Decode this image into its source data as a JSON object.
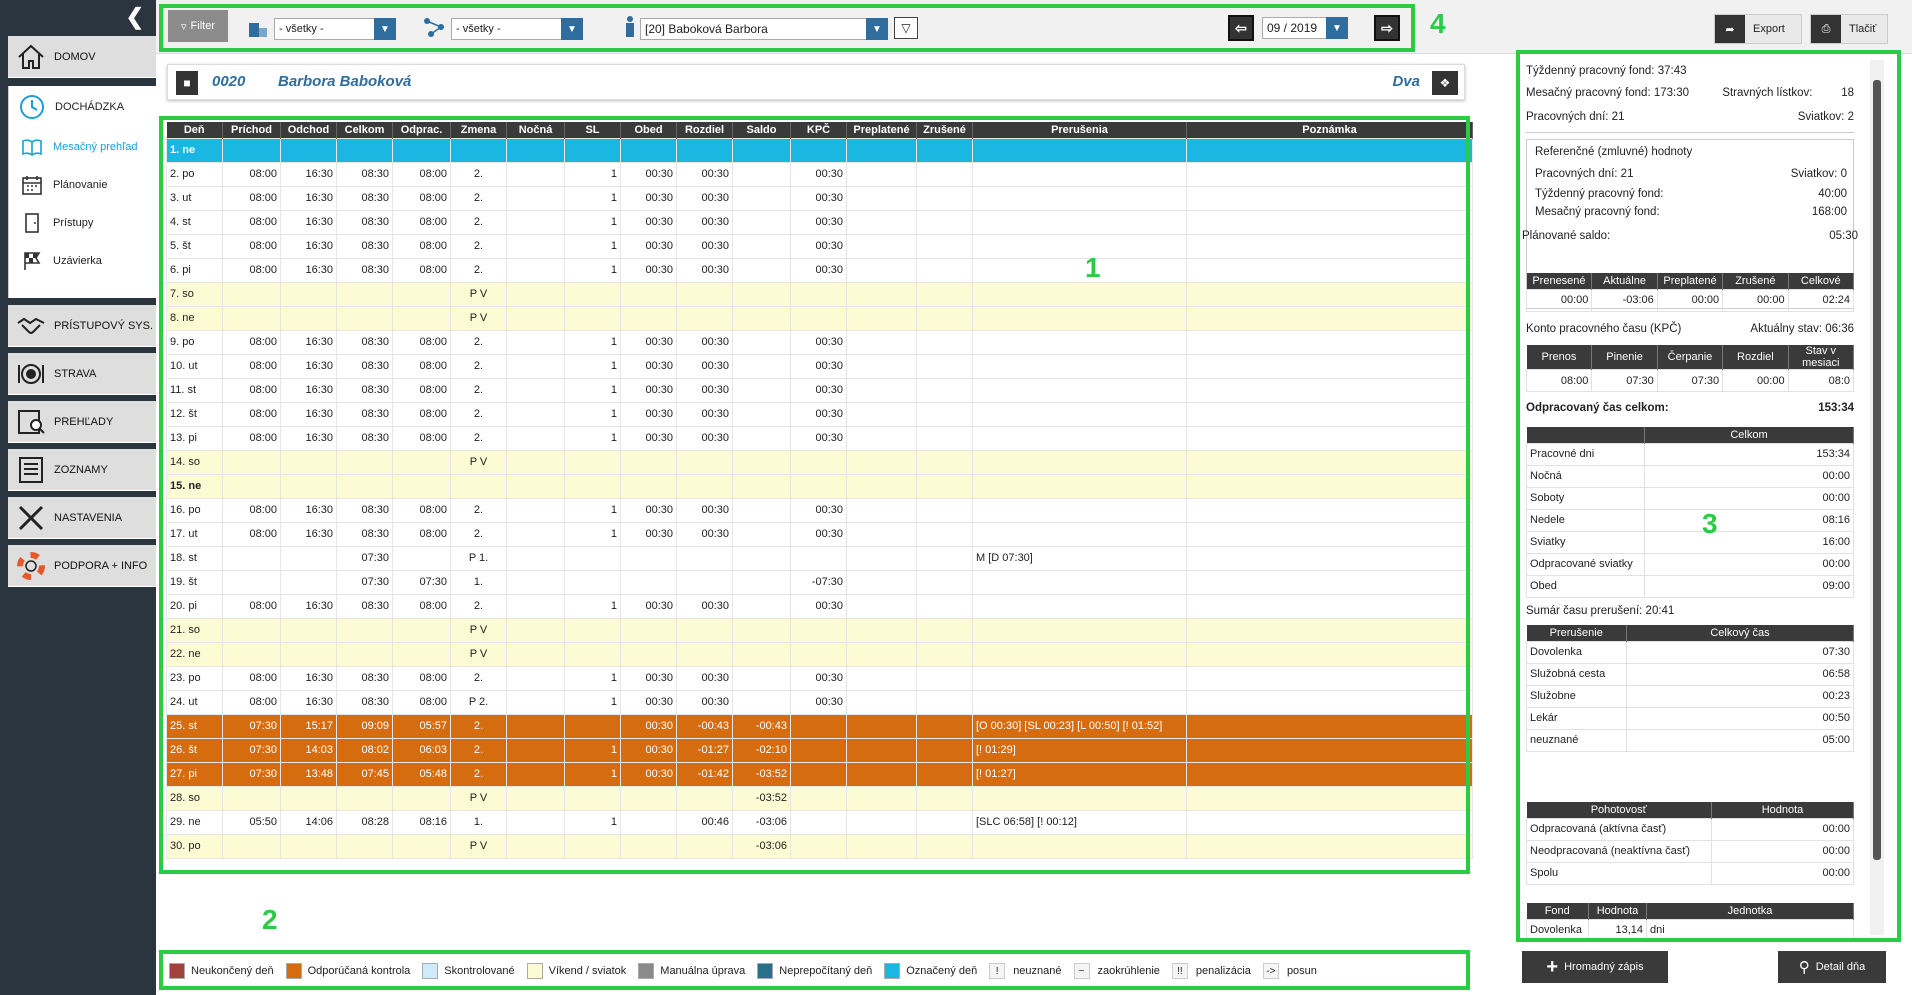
{
  "sidebar": {
    "items": [
      {
        "label": "DOMOV",
        "icon": "home-icon"
      },
      {
        "label": "DOCHÁDZKA",
        "icon": "clock-icon"
      },
      {
        "label": "PRÍSTUPOVÝ SYS.",
        "icon": "handshake-icon"
      },
      {
        "label": "STRAVA",
        "icon": "plate-icon"
      },
      {
        "label": "PREHĽADY",
        "icon": "report-icon"
      },
      {
        "label": "ZOZNAMY",
        "icon": "list-icon"
      },
      {
        "label": "NASTAVENIA",
        "icon": "tools-icon"
      },
      {
        "label": "PODPORA + INFO",
        "icon": "lifebuoy-icon"
      }
    ],
    "submenu": [
      {
        "label": "Mesačný prehľad",
        "icon": "book-icon",
        "active": true
      },
      {
        "label": "Plánovanie",
        "icon": "calendar-icon"
      },
      {
        "label": "Prístupy",
        "icon": "door-icon"
      },
      {
        "label": "Uzávierka",
        "icon": "flag-icon"
      }
    ]
  },
  "toolbar": {
    "filter_label": "Filter",
    "dept_value": "- všetky -",
    "group_value": "- všetky -",
    "employee_value": "[20] Baboková Barbora",
    "period_value": "09 / 2019",
    "export_label": "Export",
    "print_label": "Tlačiť"
  },
  "employee": {
    "number": "0020",
    "name": "Barbora Baboková",
    "shift": "Dva"
  },
  "annotations": {
    "a1": "1",
    "a2": "2",
    "a3": "3",
    "a4": "4"
  },
  "grid": {
    "headers": [
      "Deň",
      "Príchod",
      "Odchod",
      "Celkom",
      "Odprac.",
      "Zmena",
      "Nočná",
      "SL",
      "Obed",
      "Rozdiel",
      "Saldo",
      "KPČ",
      "Preplatené",
      "Zrušené",
      "Prerušenia",
      "Poznámka"
    ],
    "rows": [
      {
        "t": "selected",
        "c": [
          "1. ne",
          "",
          "",
          "",
          "",
          "",
          "",
          "",
          "",
          "",
          "",
          "",
          "",
          "",
          "",
          ""
        ]
      },
      {
        "t": "normal",
        "c": [
          "2. po",
          "08:00",
          "16:30",
          "08:30",
          "08:00",
          "2.",
          "",
          "1",
          "00:30",
          "00:30",
          "",
          "00:30",
          "",
          "",
          "",
          ""
        ]
      },
      {
        "t": "normal",
        "c": [
          "3. ut",
          "08:00",
          "16:30",
          "08:30",
          "08:00",
          "2.",
          "",
          "1",
          "00:30",
          "00:30",
          "",
          "00:30",
          "",
          "",
          "",
          ""
        ]
      },
      {
        "t": "normal",
        "c": [
          "4. st",
          "08:00",
          "16:30",
          "08:30",
          "08:00",
          "2.",
          "",
          "1",
          "00:30",
          "00:30",
          "",
          "00:30",
          "",
          "",
          "",
          ""
        ]
      },
      {
        "t": "normal",
        "c": [
          "5. št",
          "08:00",
          "16:30",
          "08:30",
          "08:00",
          "2.",
          "",
          "1",
          "00:30",
          "00:30",
          "",
          "00:30",
          "",
          "",
          "",
          ""
        ]
      },
      {
        "t": "normal",
        "c": [
          "6. pi",
          "08:00",
          "16:30",
          "08:30",
          "08:00",
          "2.",
          "",
          "1",
          "00:30",
          "00:30",
          "",
          "00:30",
          "",
          "",
          "",
          ""
        ]
      },
      {
        "t": "weekend",
        "c": [
          "7. so",
          "",
          "",
          "",
          "",
          "P V",
          "",
          "",
          "",
          "",
          "",
          "",
          "",
          "",
          "",
          ""
        ]
      },
      {
        "t": "weekend",
        "c": [
          "8. ne",
          "",
          "",
          "",
          "",
          "P V",
          "",
          "",
          "",
          "",
          "",
          "",
          "",
          "",
          "",
          ""
        ]
      },
      {
        "t": "normal",
        "c": [
          "9. po",
          "08:00",
          "16:30",
          "08:30",
          "08:00",
          "2.",
          "",
          "1",
          "00:30",
          "00:30",
          "",
          "00:30",
          "",
          "",
          "",
          ""
        ]
      },
      {
        "t": "normal",
        "c": [
          "10. ut",
          "08:00",
          "16:30",
          "08:30",
          "08:00",
          "2.",
          "",
          "1",
          "00:30",
          "00:30",
          "",
          "00:30",
          "",
          "",
          "",
          ""
        ]
      },
      {
        "t": "normal",
        "c": [
          "11. st",
          "08:00",
          "16:30",
          "08:30",
          "08:00",
          "2.",
          "",
          "1",
          "00:30",
          "00:30",
          "",
          "00:30",
          "",
          "",
          "",
          ""
        ]
      },
      {
        "t": "normal",
        "c": [
          "12. št",
          "08:00",
          "16:30",
          "08:30",
          "08:00",
          "2.",
          "",
          "1",
          "00:30",
          "00:30",
          "",
          "00:30",
          "",
          "",
          "",
          ""
        ]
      },
      {
        "t": "normal",
        "c": [
          "13. pi",
          "08:00",
          "16:30",
          "08:30",
          "08:00",
          "2.",
          "",
          "1",
          "00:30",
          "00:30",
          "",
          "00:30",
          "",
          "",
          "",
          ""
        ]
      },
      {
        "t": "weekend",
        "c": [
          "14. so",
          "",
          "",
          "",
          "",
          "P V",
          "",
          "",
          "",
          "",
          "",
          "",
          "",
          "",
          "",
          ""
        ]
      },
      {
        "t": "weekend bold",
        "c": [
          "15. ne",
          "",
          "",
          "",
          "",
          "",
          "",
          "",
          "",
          "",
          "",
          "",
          "",
          "",
          "",
          ""
        ]
      },
      {
        "t": "normal",
        "c": [
          "16. po",
          "08:00",
          "16:30",
          "08:30",
          "08:00",
          "2.",
          "",
          "1",
          "00:30",
          "00:30",
          "",
          "00:30",
          "",
          "",
          "",
          ""
        ]
      },
      {
        "t": "normal",
        "c": [
          "17. ut",
          "08:00",
          "16:30",
          "08:30",
          "08:00",
          "2.",
          "",
          "1",
          "00:30",
          "00:30",
          "",
          "00:30",
          "",
          "",
          "",
          ""
        ]
      },
      {
        "t": "normal",
        "c": [
          "18. st",
          "",
          "",
          "07:30",
          "",
          "P 1.",
          "",
          "",
          "",
          "",
          "",
          "",
          "",
          "",
          "M [D 07:30]",
          ""
        ]
      },
      {
        "t": "normal",
        "c": [
          "19. št",
          "",
          "",
          "07:30",
          "07:30",
          "1.",
          "",
          "",
          "",
          "",
          "",
          "-07:30",
          "",
          "",
          "",
          ""
        ]
      },
      {
        "t": "normal",
        "c": [
          "20. pi",
          "08:00",
          "16:30",
          "08:30",
          "08:00",
          "2.",
          "",
          "1",
          "00:30",
          "00:30",
          "",
          "00:30",
          "",
          "",
          "",
          ""
        ]
      },
      {
        "t": "weekend",
        "c": [
          "21. so",
          "",
          "",
          "",
          "",
          "P V",
          "",
          "",
          "",
          "",
          "",
          "",
          "",
          "",
          "",
          ""
        ]
      },
      {
        "t": "weekend",
        "c": [
          "22. ne",
          "",
          "",
          "",
          "",
          "P V",
          "",
          "",
          "",
          "",
          "",
          "",
          "",
          "",
          "",
          ""
        ]
      },
      {
        "t": "normal",
        "c": [
          "23. po",
          "08:00",
          "16:30",
          "08:30",
          "08:00",
          "2.",
          "",
          "1",
          "00:30",
          "00:30",
          "",
          "00:30",
          "",
          "",
          "",
          ""
        ]
      },
      {
        "t": "normal",
        "c": [
          "24. ut",
          "08:00",
          "16:30",
          "08:30",
          "08:00",
          "P 2.",
          "",
          "1",
          "00:30",
          "00:30",
          "",
          "00:30",
          "",
          "",
          "",
          ""
        ]
      },
      {
        "t": "control",
        "c": [
          "25. st",
          "07:30",
          "15:17",
          "09:09",
          "05:57",
          "2.",
          "",
          "",
          "00:30",
          "-00:43",
          "-00:43",
          "",
          "",
          "",
          "[O 00:30] [SL 00:23] [L 00:50] [! 01:52]",
          ""
        ]
      },
      {
        "t": "control",
        "c": [
          "26. št",
          "07:30",
          "14:03",
          "08:02",
          "06:03",
          "2.",
          "",
          "1",
          "00:30",
          "-01:27",
          "-02:10",
          "",
          "",
          "",
          "[! 01:29]",
          ""
        ]
      },
      {
        "t": "control",
        "c": [
          "27. pi",
          "07:30",
          "13:48",
          "07:45",
          "05:48",
          "2.",
          "",
          "1",
          "00:30",
          "-01:42",
          "-03:52",
          "",
          "",
          "",
          "[! 01:27]",
          ""
        ]
      },
      {
        "t": "weekend",
        "c": [
          "28. so",
          "",
          "",
          "",
          "",
          "P V",
          "",
          "",
          "",
          "",
          "-03:52",
          "",
          "",
          "",
          "",
          ""
        ]
      },
      {
        "t": "normal",
        "c": [
          "29. ne",
          "05:50",
          "14:06",
          "08:28",
          "08:16",
          "1.",
          "",
          "1",
          "",
          "00:46",
          "-03:06",
          "",
          "",
          "",
          "[SLC 06:58] [! 00:12]",
          ""
        ]
      },
      {
        "t": "weekend",
        "c": [
          "30. po",
          "",
          "",
          "",
          "",
          "P V",
          "",
          "",
          "",
          "",
          "-03:06",
          "",
          "",
          "",
          "",
          ""
        ]
      }
    ]
  },
  "legend": [
    {
      "label": "Neukončený deň",
      "color": "#a0413c"
    },
    {
      "label": "Odporúčaná kontrola",
      "color": "#d66c10"
    },
    {
      "label": "Skontrolované",
      "color": "#cfeaf8"
    },
    {
      "label": "Víkend / sviatok",
      "color": "#fdfbd4"
    },
    {
      "label": "Manuálna úprava",
      "color": "#8a8a8a"
    },
    {
      "label": "Neprepočítaný deň",
      "color": "#2a6f8a"
    },
    {
      "label": "Označený deň",
      "color": "#1ab7e3"
    },
    {
      "label": "neuznané",
      "mark": "!"
    },
    {
      "label": "zaokrúhlenie",
      "mark": "~"
    },
    {
      "label": "penalizácia",
      "mark": "!!"
    },
    {
      "label": "posun",
      "mark": "->"
    }
  ],
  "summary": {
    "weekly_fund_label": "Týždenný pracovný fond:",
    "weekly_fund": "37:43",
    "monthly_fund_label": "Mesačný pracovný fond:",
    "monthly_fund": "173:30",
    "meal_label": "Stravných lístkov:",
    "meal": "18",
    "workdays_label": "Pracovných dní:",
    "workdays": "21",
    "holidays_label": "Sviatkov:",
    "holidays": "2",
    "ref_title": "Referenčné (zmluvné) hodnoty",
    "ref_workdays_label": "Pracovných dní:",
    "ref_workdays": "21",
    "ref_holidays_label": "Sviatkov:",
    "ref_holidays": "0",
    "ref_weekly_label": "Týždenný pracovný fond:",
    "ref_weekly": "40:00",
    "ref_monthly_label": "Mesačný pracovný fond:",
    "ref_monthly": "168:00",
    "plan_label": "Plánované saldo:",
    "plan_value": "05:30",
    "saldo_headers": [
      "Prenesené",
      "Aktuálne",
      "Preplatené",
      "Zrušené",
      "Celkové"
    ],
    "saldo_values": [
      "00:00",
      "-03:06",
      "00:00",
      "00:00",
      "02:24"
    ],
    "kpc_label": "Konto pracovného času (KPČ)",
    "kpc_state_label": "Aktuálny stav:",
    "kpc_state": "06:36",
    "kpc_headers": [
      "Prenos",
      "Pinenie",
      "Čerpanie",
      "Rozdiel",
      "Stav v mesiaci"
    ],
    "kpc_values": [
      "08:00",
      "07:30",
      "07:30",
      "00:00",
      "08:0"
    ],
    "worked_label": "Odpracovaný čas celkom:",
    "worked_value": "153:34",
    "worked_header": "Celkom",
    "worked_rows": [
      [
        "Pracovné dni",
        "153:34"
      ],
      [
        "Nočná",
        "00:00"
      ],
      [
        "Soboty",
        "00:00"
      ],
      [
        "Nedele",
        "08:16"
      ],
      [
        "Sviatky",
        "16:00"
      ],
      [
        "Odpracované sviatky",
        "00:00"
      ],
      [
        "Obed",
        "09:00"
      ]
    ],
    "breaks_label": "Sumár času prerušení:",
    "breaks_value": "20:41",
    "breaks_headers": [
      "Prerušenie",
      "Celkový čas"
    ],
    "breaks_rows": [
      [
        "Dovolenka",
        "07:30"
      ],
      [
        "Služobná cesta",
        "06:58"
      ],
      [
        "Služobne",
        "00:23"
      ],
      [
        "Lekár",
        "00:50"
      ],
      [
        "neuznané",
        "05:00"
      ]
    ],
    "standby_headers": [
      "Pohotovosť",
      "Hodnota"
    ],
    "standby_rows": [
      [
        "Odpracovaná (aktívna časť)",
        "00:00"
      ],
      [
        "Neodpracovaná (neaktívna časť)",
        "00:00"
      ],
      [
        "Spolu",
        "00:00"
      ]
    ],
    "fund_headers": [
      "Fond",
      "Hodnota",
      "Jednotka"
    ],
    "fund_rows": [
      [
        "Dovolenka",
        "13,14",
        "dni"
      ]
    ]
  },
  "bottom": {
    "bulk_label": "Hromadný zápis",
    "detail_label": "Detail dňa"
  }
}
